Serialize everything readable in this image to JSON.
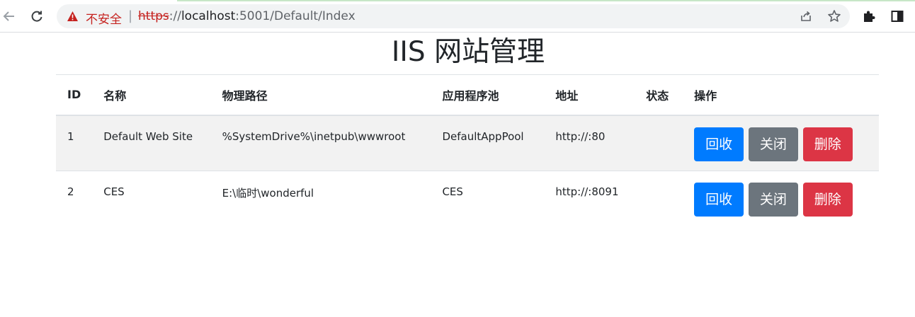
{
  "browser": {
    "security_label": "不安全",
    "separator": "|",
    "url_scheme": "https",
    "url_rest_prefix": "://",
    "url_host": "localhost",
    "url_path": ":5001/Default/Index",
    "icons": [
      "back-arrow-icon",
      "reload-icon",
      "warning-icon",
      "share-icon",
      "star-icon",
      "extensions-puzzle-icon",
      "side-panel-icon"
    ]
  },
  "page": {
    "title": "IIS 网站管理"
  },
  "table": {
    "headers": {
      "id": "ID",
      "name": "名称",
      "path": "物理路径",
      "pool": "应用程序池",
      "address": "地址",
      "status": "状态",
      "actions": "操作"
    },
    "rows": [
      {
        "id": "1",
        "name": "Default Web Site",
        "path": "%SystemDrive%\\inetpub\\wwwroot",
        "pool": "DefaultAppPool",
        "address": "http://:80",
        "status": ""
      },
      {
        "id": "2",
        "name": "CES",
        "path": "E:\\临时\\wonderful",
        "pool": "CES",
        "address": "http://:8091",
        "status": ""
      }
    ],
    "buttons": {
      "recycle": "回收",
      "stop": "关闭",
      "delete": "删除"
    }
  },
  "colors": {
    "primary": "#007bff",
    "secondary": "#6c757d",
    "danger": "#dc3545",
    "insecure": "#c5221f"
  }
}
